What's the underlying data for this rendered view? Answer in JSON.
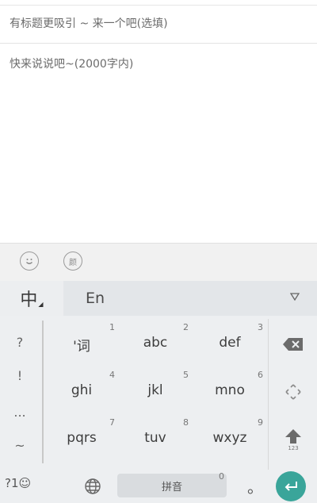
{
  "compose": {
    "title_placeholder": "有标题更吸引 ~ 来一个吧(选填)",
    "content_placeholder": "快来说说吧~(2000字内)"
  },
  "emoji_bar": {
    "emoji_icon": "smiley-icon",
    "expression_icon": "expression-icon",
    "expression_label": "颜"
  },
  "keyboard": {
    "lang_cn": "中",
    "lang_en": "En",
    "dropdown_icon": "triangle-down-icon",
    "left_symbols": [
      "?",
      "!",
      "...",
      "~"
    ],
    "keys": [
      {
        "label": "'词",
        "num": "1"
      },
      {
        "label": "abc",
        "num": "2"
      },
      {
        "label": "def",
        "num": "3"
      },
      {
        "label": "ghi",
        "num": "4"
      },
      {
        "label": "jkl",
        "num": "5"
      },
      {
        "label": "mno",
        "num": "6"
      },
      {
        "label": "pqrs",
        "num": "7"
      },
      {
        "label": "tuv",
        "num": "8"
      },
      {
        "label": "wxyz",
        "num": "9"
      }
    ],
    "right_keys": {
      "backspace_icon": "backspace-icon",
      "move_icon": "cursor-move-icon",
      "shift_icon": "shift-icon",
      "shift_sub": "123"
    },
    "bottom": {
      "symbols_label": "?1☺",
      "globe_icon": "globe-icon",
      "space_label": "拼音",
      "space_num": "0",
      "period": "。",
      "enter_icon": "enter-icon"
    }
  }
}
